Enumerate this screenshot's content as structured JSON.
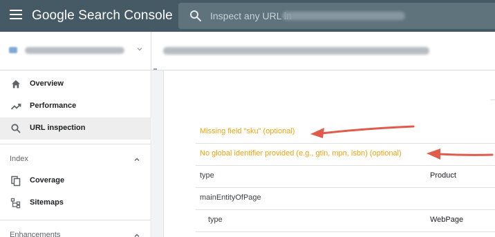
{
  "app": {
    "title": "Google Search Console"
  },
  "search": {
    "placeholder": "Inspect any URL in"
  },
  "sidebar": {
    "items": [
      {
        "label": "Overview",
        "icon": "home-icon"
      },
      {
        "label": "Performance",
        "icon": "trending-up-icon"
      },
      {
        "label": "URL inspection",
        "icon": "search-icon",
        "active": true
      }
    ],
    "sections": [
      {
        "label": "Index",
        "items": [
          {
            "label": "Coverage",
            "icon": "copy-pages-icon"
          },
          {
            "label": "Sitemaps",
            "icon": "sitemap-icon"
          }
        ]
      },
      {
        "label": "Enhancements",
        "items": []
      }
    ]
  },
  "details": {
    "warnings": [
      "Missing field \"sku\" (optional)",
      "No global identifier provided (e.g., gtin, mpn, isbn) (optional)"
    ],
    "rows": [
      {
        "key": "type",
        "value": "Product"
      },
      {
        "key": "mainEntityOfPage",
        "value": ""
      },
      {
        "key": "type",
        "value": "WebPage"
      }
    ]
  },
  "colors": {
    "topbar": "#455a64",
    "search_box": "#5f737d",
    "warning_text": "#f1a20b",
    "annotation_arrow": "#e05b4c",
    "active_nav": "#eeeeee"
  }
}
